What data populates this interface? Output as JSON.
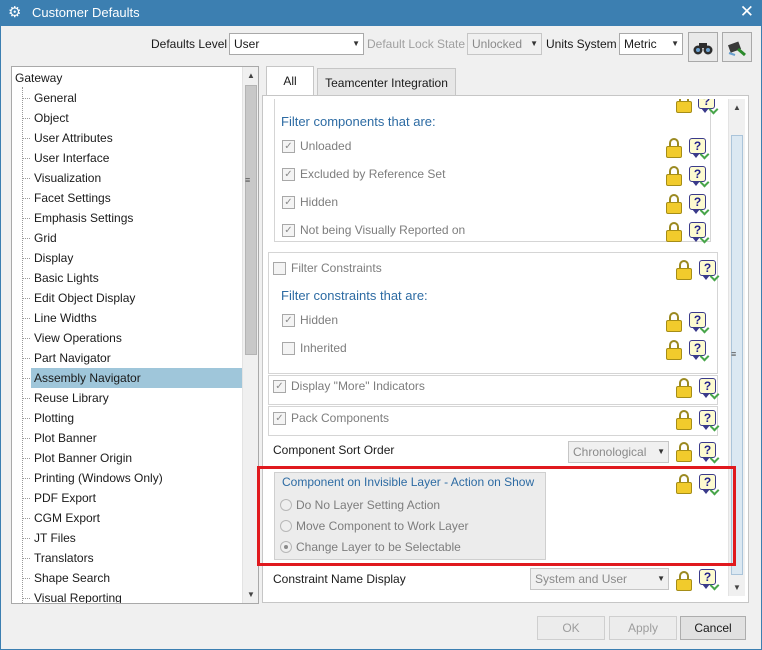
{
  "window": {
    "title": "Customer Defaults",
    "gear_icon": "gear-icon",
    "close_icon": "close-icon",
    "close_glyph": "✕",
    "gear_glyph": "⚙"
  },
  "toolbar": {
    "defaults_level_label": "Defaults Level",
    "defaults_level_value": "User",
    "lock_state_label": "Default Lock State",
    "lock_state_value": "Unlocked",
    "units_label": "Units System",
    "units_value": "Metric",
    "find_icon": "binoculars-icon",
    "apply_icon": "brush-icon"
  },
  "tree": {
    "root": "Gateway",
    "items": [
      "General",
      "Object",
      "User Attributes",
      "User Interface",
      "Visualization",
      "Facet Settings",
      "Emphasis Settings",
      "Grid",
      "Display",
      "Basic Lights",
      "Edit Object Display",
      "Line Widths",
      "View Operations",
      "Part Navigator",
      "Assembly Navigator",
      "Reuse Library",
      "Plotting",
      "Plot Banner",
      "Plot Banner Origin",
      "Printing (Windows Only)",
      "PDF Export",
      "CGM Export",
      "JT Files",
      "Translators",
      "Shape Search",
      "Visual Reporting"
    ],
    "selected": "Assembly Navigator"
  },
  "tabs": [
    "All",
    "Teamcenter Integration"
  ],
  "panel": {
    "filter_components_title": "Filter components that are:",
    "filter_components": [
      {
        "label": "Unloaded",
        "checked": true
      },
      {
        "label": "Excluded by Reference Set",
        "checked": true
      },
      {
        "label": "Hidden",
        "checked": true
      },
      {
        "label": "Not being Visually Reported on",
        "checked": true
      }
    ],
    "filter_constraints_label": "Filter Constraints",
    "filter_constraints_checked": false,
    "filter_constraints_title": "Filter constraints that are:",
    "filter_constraints": [
      {
        "label": "Hidden",
        "checked": true
      },
      {
        "label": "Inherited",
        "checked": false
      }
    ],
    "display_more_label": "Display \"More\" Indicators",
    "display_more_checked": true,
    "pack_components_label": "Pack Components",
    "pack_components_checked": true,
    "sort_order_label": "Component Sort Order",
    "sort_order_value": "Chronological",
    "invisible_layer_title": "Component on Invisible Layer - Action on Show",
    "invisible_layer_options": [
      {
        "label": "Do No Layer Setting Action",
        "selected": false
      },
      {
        "label": "Move Component to Work Layer",
        "selected": false
      },
      {
        "label": "Change Layer to be Selectable",
        "selected": true
      }
    ],
    "constraint_name_label": "Constraint Name Display",
    "constraint_name_value": "System and User"
  },
  "buttons": {
    "ok": "OK",
    "apply": "Apply",
    "cancel": "Cancel"
  },
  "glyphs": {
    "check": "✓",
    "help": "?",
    "down": "▼",
    "up": "▲",
    "grip": "≡"
  },
  "colors": {
    "titlebar": "#3c7fb1",
    "selection": "#9fc6da",
    "highlight_box": "#e0191e",
    "group_title": "#2d6ba3"
  }
}
